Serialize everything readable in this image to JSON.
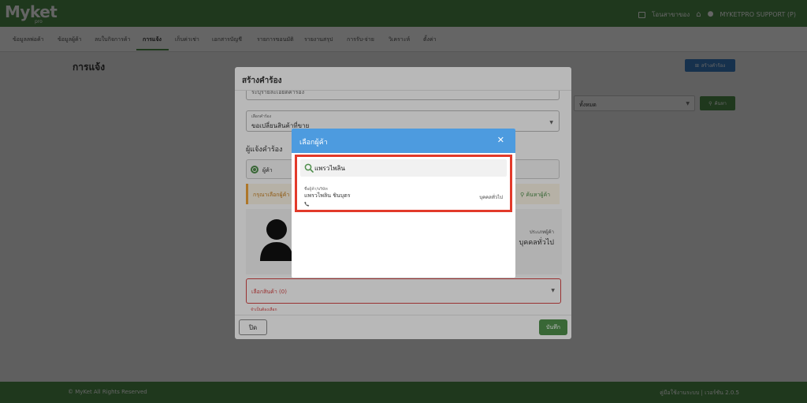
{
  "app": {
    "logo": "Myket",
    "logo_sub": "pro"
  },
  "topbar": {
    "item1": "โอนสาขาของ",
    "user": "MYKETPRO SUPPORT (P)"
  },
  "nav": [
    {
      "label": "ข้อมูลลพ่อค้า"
    },
    {
      "label": "ข้อมูลผู้ค้า"
    },
    {
      "label": "ลบใบกิจการค้า"
    },
    {
      "label": "การแจ้ง"
    },
    {
      "label": "เก็บค่าเช่า"
    },
    {
      "label": "เอกสารบัญชี"
    },
    {
      "label": "รายการขอนมัติ"
    },
    {
      "label": "รายงานสรุป"
    },
    {
      "label": "การรับ-จ่าย"
    },
    {
      "label": "วิเคราะห์"
    },
    {
      "label": "ตั้งค่า"
    }
  ],
  "page": {
    "title": "การแจ้ง",
    "create_button": "สร้างคำร้อง",
    "filter_value": "ทั้งหมด",
    "search_button": "ค้นหา"
  },
  "modal": {
    "title": "สร้างคำร้อง",
    "hidden_field_value": "ระบุรายละเอียดคำร้อง",
    "request_label": "เลือกคำร้อง",
    "request_value": "ขอเปลี่ยนสินค้าที่ขาย",
    "requester_title": "ผู้แจ้งคำร้อง",
    "radio_label": "ผู้ค้า",
    "warning": "กรุณาเลือกผู้ค้า",
    "find_supplier": "ค้นหาผู้ค้า",
    "type_label": "ประเภทผู้ค้า",
    "type_value": "บุคคลทั่วไป",
    "product_placeholder": "เลือกสินค้า (0)",
    "product_error": "จำเป็นต้องเลือก",
    "close_button": "ปิด",
    "save_button": "บันทึก"
  },
  "dialog": {
    "title": "เลือกผู้ค้า",
    "search_value": "แพรวไพลิน",
    "result": {
      "label": "ชื่อผู้ค้า/บริษัท",
      "name": "แพรวไพลิน ชินบุตร",
      "type": "บุคคลทั่วไป"
    }
  },
  "footer": {
    "copyright": "© MyKet All Rights Reserved",
    "version": "คู่มือใช้งานระบบ | เวอร์ชัน 2.0.5"
  },
  "colors": {
    "brand": "#4f8f4c",
    "dialog_header": "#4d9bdf",
    "highlight": "#e23a2a",
    "error": "#d64545",
    "primary_button": "#3a7fc4"
  },
  "icons": [
    "square-icon",
    "home-icon",
    "user-icon",
    "plus-icon",
    "search-icon",
    "close-icon",
    "phone-icon",
    "chevron-down-icon",
    "avatar-icon"
  ]
}
